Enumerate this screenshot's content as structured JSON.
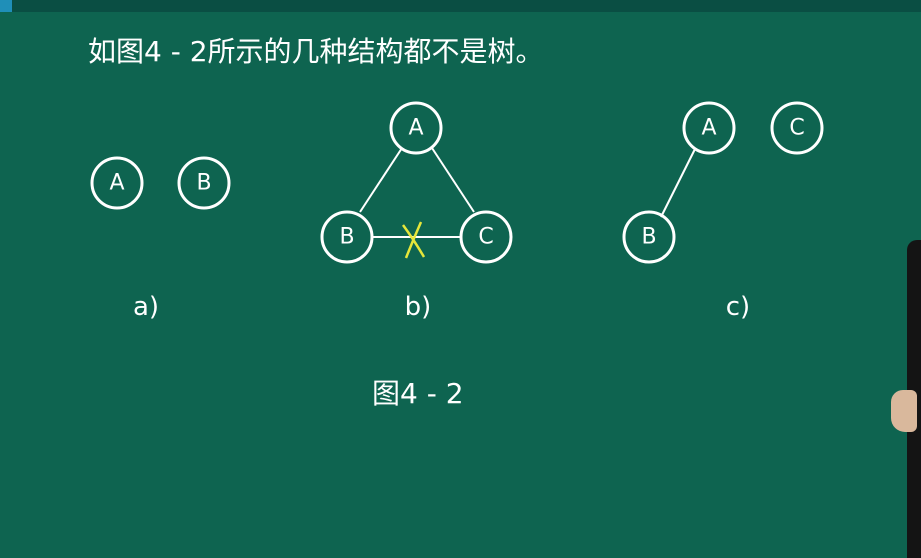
{
  "slide": {
    "heading": "如图4 - 2所示的几种结构都不是树。",
    "caption": "图4 - 2"
  },
  "diagrams": {
    "a": {
      "label": "a)",
      "nodes": [
        "A",
        "B"
      ]
    },
    "b": {
      "label": "b)",
      "nodes": [
        "A",
        "B",
        "C"
      ],
      "edges": [
        [
          "A",
          "B"
        ],
        [
          "A",
          "C"
        ],
        [
          "B",
          "C"
        ]
      ],
      "crossed_edge": [
        "B",
        "C"
      ]
    },
    "c": {
      "label": "c)",
      "nodes": [
        "A",
        "C",
        "B"
      ],
      "edges": [
        [
          "A",
          "B"
        ]
      ]
    }
  },
  "colors": {
    "board": "#0e6450",
    "chalk": "#ffffff",
    "cross_mark": "#e6e63a"
  }
}
